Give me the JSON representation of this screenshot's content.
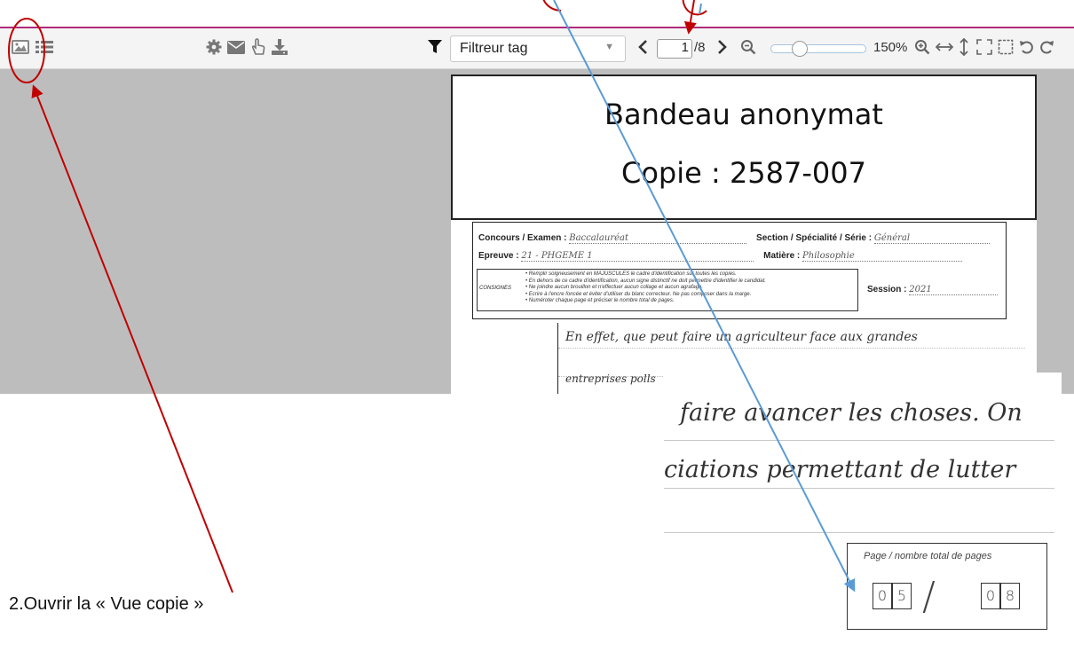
{
  "toolbar": {
    "filter_placeholder": "Filtreur tag",
    "current_page": "1",
    "page_total": "/8",
    "zoom_level": "150%"
  },
  "document": {
    "bandeau_title": "Bandeau anonymat",
    "copy_id": "Copie : 2587-007",
    "form": {
      "concours_label": "Concours / Examen :",
      "concours_value": "Baccalauréat",
      "section_label": "Section / Spécialité / Série :",
      "section_value": "Général",
      "epreuve_label": "Epreuve :",
      "epreuve_value": "21 - PHGEME 1",
      "matiere_label": "Matière :",
      "matiere_value": "Philosophie",
      "consignes_label": "CONSIGNES",
      "consignes": [
        "Remplir soigneusement en MAJUSCULES le cadre d'identification sur toutes les copies.",
        "En dehors de ce cadre d'identification, aucun signe distinctif ne doit permettre d'identifier le candidat.",
        "Ne joindre aucun brouillon et n'effectuer aucun collage et aucun agrafage.",
        "Ecrire à l'encre foncée et éviter d'utiliser du blanc correcteur. Ne pas composer dans la marge.",
        "Numéroter chaque page et préciser le nombre total de pages."
      ],
      "session_label": "Session :",
      "session_value": "2021"
    },
    "handwriting": [
      "En effet, que peut faire un agriculteur face aux grandes",
      "entreprises polls"
    ]
  },
  "zoom_crop": {
    "lines": [
      "faire avancer les choses. On",
      "ciations permettant de lutter"
    ],
    "page_box_label": "Page / nombre total de pages",
    "page_digits": [
      "0",
      "5"
    ],
    "total_digits": [
      "0",
      "8"
    ]
  },
  "annotation": {
    "instruction": "2.Ouvrir la « Vue copie »",
    "arrow_red": "#c00000",
    "arrow_blue": "#5b9bd5"
  }
}
